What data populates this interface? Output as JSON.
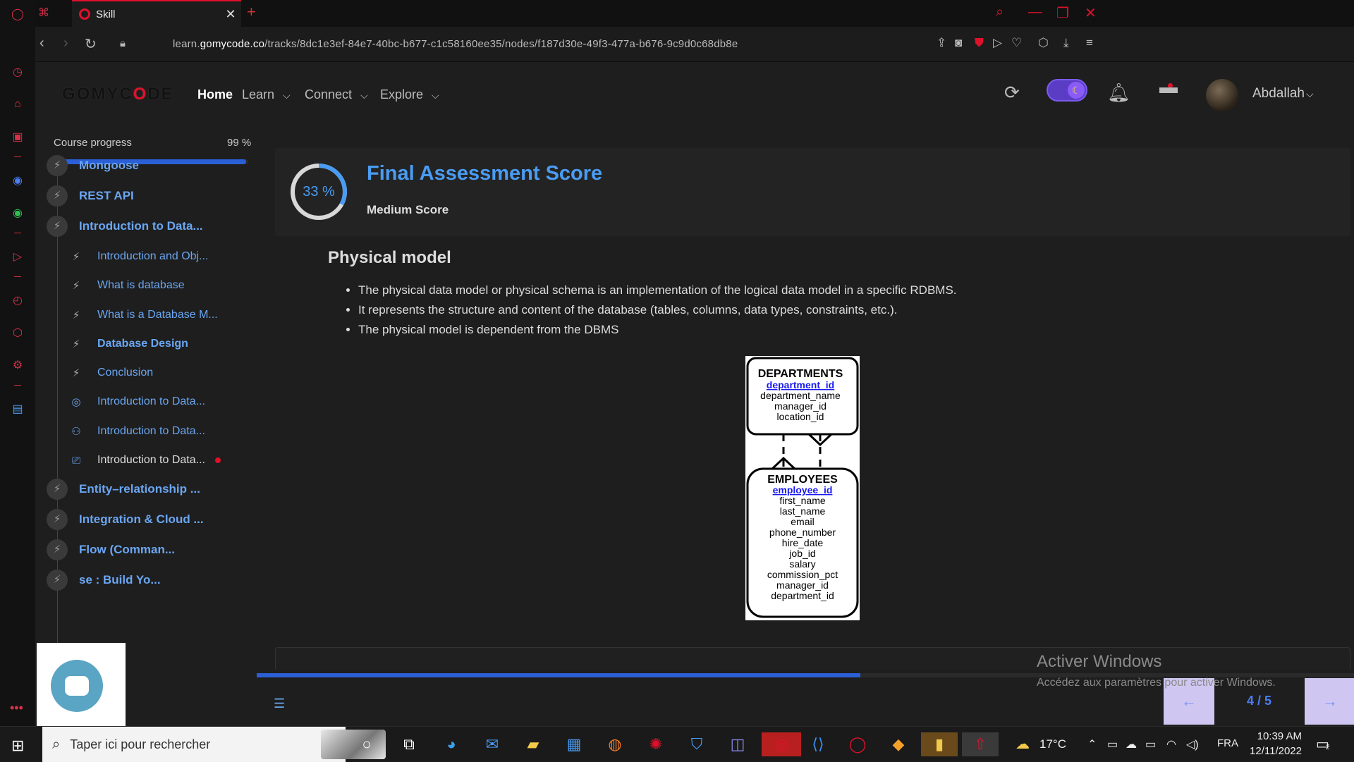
{
  "browser": {
    "tab_title": "Skill",
    "tab_close": "✕",
    "new_tab": "+",
    "url_prefix": "learn.",
    "url_domain": "gomycode.co",
    "url_path": "/tracks/8dc1e3ef-84e7-40bc-b677-c1c58160ee35/nodes/f187d30e-49f3-477a-b676-9c9d0c68db8e"
  },
  "header": {
    "logo_a": "GOMYC",
    "logo_o": "O",
    "logo_b": "DE",
    "nav": [
      {
        "label": "Home"
      },
      {
        "label": "Learn"
      },
      {
        "label": "Connect"
      },
      {
        "label": "Explore"
      }
    ],
    "username": "Abdallah"
  },
  "sidebar": {
    "progress_label": "Course progress",
    "progress_pct": "99 %",
    "progress_value": 0.99,
    "modules_top": [
      {
        "label": "Mongoose"
      },
      {
        "label": "REST API"
      },
      {
        "label": "Introduction to Data..."
      }
    ],
    "lessons": [
      {
        "label": "Introduction and Obj...",
        "icon": "bolt-icon"
      },
      {
        "label": "What is database",
        "icon": "bolt-icon"
      },
      {
        "label": "What is a Database M...",
        "icon": "bolt-icon"
      },
      {
        "label": "Database Design",
        "icon": "bolt-icon"
      },
      {
        "label": "Conclusion",
        "icon": "bolt-icon"
      },
      {
        "label": "Introduction to Data...",
        "icon": "target-icon"
      },
      {
        "label": "Introduction to Data...",
        "icon": "people-icon"
      },
      {
        "label": "Introduction to Data...",
        "icon": "presentation-icon"
      }
    ],
    "modules_bottom": [
      {
        "label": "Entity–relationship ..."
      },
      {
        "label": "Integration & Cloud ..."
      },
      {
        "label": "Flow (Comman..."
      },
      {
        "label": "se : Build Yo..."
      }
    ]
  },
  "score": {
    "percent_text": "33 %",
    "percent_value": 0.33,
    "title": "Final Assessment Score",
    "subtitle": "Medium Score"
  },
  "content": {
    "section_title": "Physical model",
    "bullets": [
      "The physical data model or physical schema is an implementation of the logical data model in a specific RDBMS.",
      "It represents the structure and content of the database (tables, columns, data types, constraints, etc.).",
      "The physical model is dependent from the DBMS"
    ],
    "diagram": {
      "departments_title": "DEPARTMENTS",
      "departments_key": "department_id",
      "departments_fields": [
        "department_name",
        "manager_id",
        "location_id"
      ],
      "employees_title": "EMPLOYEES",
      "employees_key": "employee_id",
      "employees_fields": [
        "first_name",
        "last_name",
        "email",
        "phone_number",
        "hire_date",
        "job_id",
        "salary",
        "commission_pct",
        "manager_id",
        "department_id"
      ]
    }
  },
  "pager": {
    "prev": "←",
    "count": "4 / 5",
    "next": "→",
    "page_progress_value": 0.55
  },
  "watermark": {
    "title": "Activer Windows",
    "subtitle": "Accédez aux paramètres pour activer Windows."
  },
  "taskbar": {
    "search_placeholder": "Taper ici pour rechercher",
    "temperature": "17°C",
    "language": "FRA",
    "time": "10:39 AM",
    "date": "12/11/2022",
    "notif_count": "2"
  },
  "colors": {
    "accent_blue": "#4a9cf2",
    "opera_red": "#e0112b",
    "progress_blue": "#2b5fd6"
  }
}
